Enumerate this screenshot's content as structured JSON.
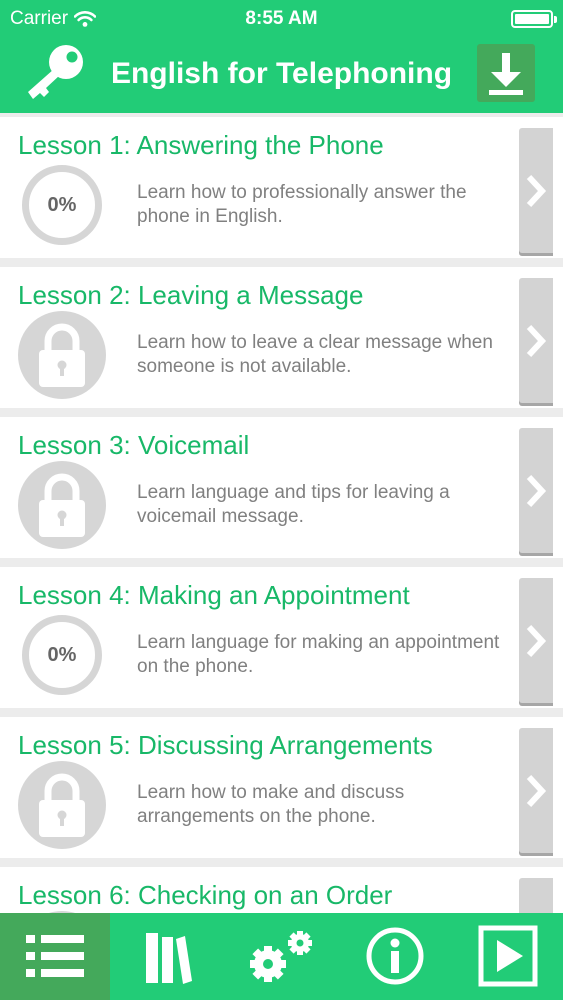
{
  "status_bar": {
    "carrier": "Carrier",
    "time": "8:55 AM"
  },
  "header": {
    "title": "English for Telephoning",
    "left_icon": "key-icon",
    "right_icon": "download-icon"
  },
  "colors": {
    "accent": "#22cc77",
    "accent_dark": "#44a95b",
    "title_green": "#18b868",
    "description_gray": "#808080",
    "disabled_gray": "#d6d6d6"
  },
  "lessons": [
    {
      "title": "Lesson 1: Answering the Phone",
      "status": "progress",
      "progress": "0%",
      "description": "Learn how to professionally answer the phone in English."
    },
    {
      "title": "Lesson 2: Leaving a Message",
      "status": "locked",
      "description": "Learn how to leave a clear message when someone is not available."
    },
    {
      "title": "Lesson 3: Voicemail",
      "status": "locked",
      "description": "Learn language and tips for leaving a voicemail message."
    },
    {
      "title": "Lesson 4: Making an Appointment",
      "status": "progress",
      "progress": "0%",
      "description": "Learn language for making an appointment on the phone."
    },
    {
      "title": "Lesson 5: Discussing Arrangements",
      "status": "locked",
      "description": "Learn how to make and discuss arrangements on the phone."
    },
    {
      "title": "Lesson 6: Checking on an Order",
      "status": "locked",
      "description": ""
    }
  ],
  "tab_bar": {
    "tabs": [
      {
        "icon": "list-icon",
        "active": true
      },
      {
        "icon": "books-icon",
        "active": false
      },
      {
        "icon": "gears-icon",
        "active": false
      },
      {
        "icon": "info-icon",
        "active": false
      },
      {
        "icon": "play-icon",
        "active": false
      }
    ]
  }
}
